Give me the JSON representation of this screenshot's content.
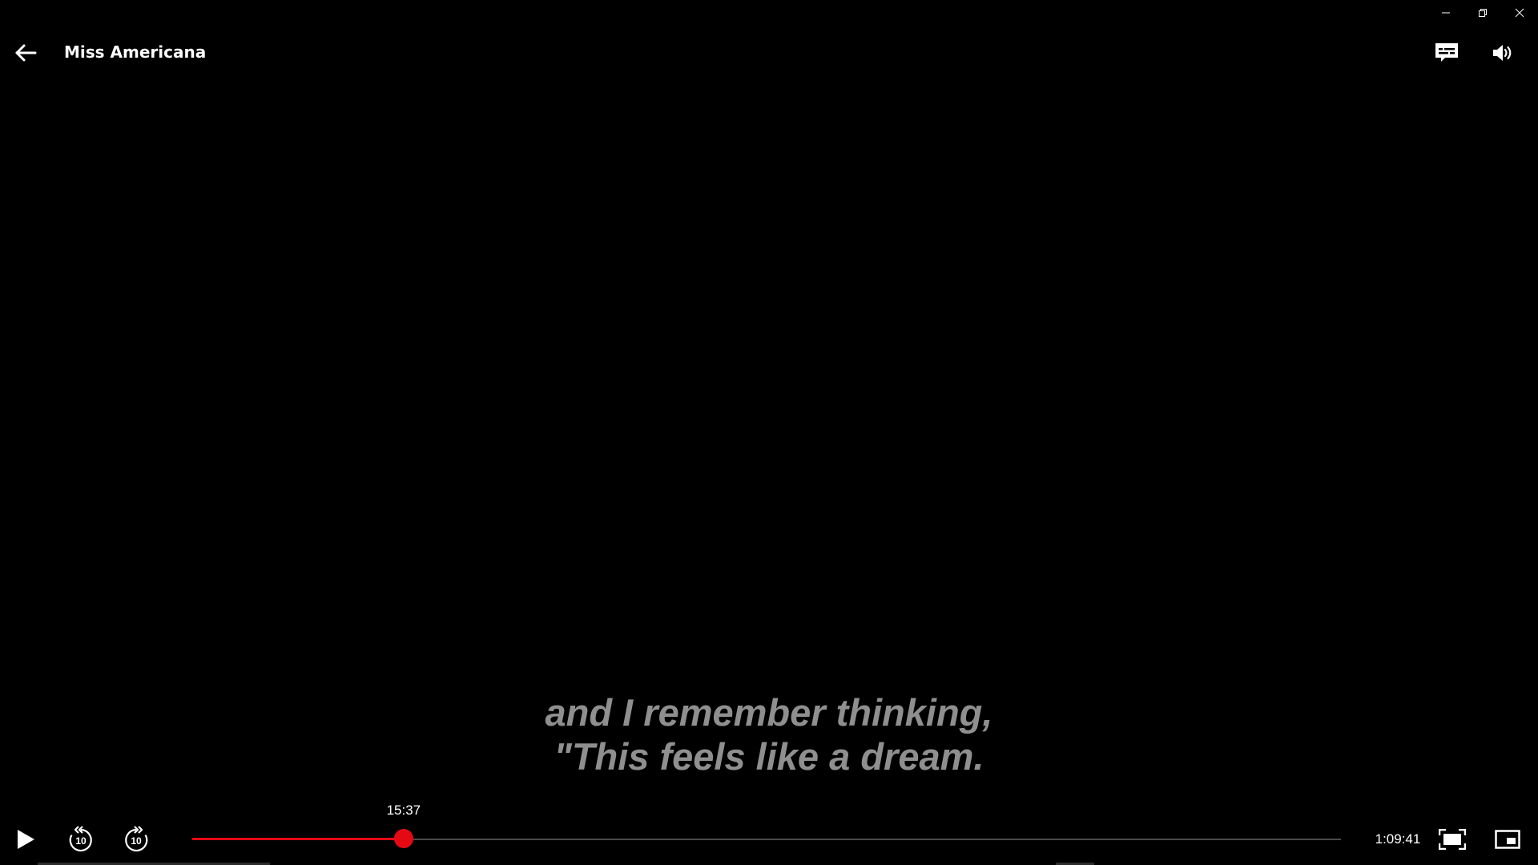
{
  "window": {
    "minimize_icon": "minimize-icon",
    "restore_icon": "restore-icon",
    "close_icon": "close-icon"
  },
  "header": {
    "back_icon": "back-arrow-icon",
    "title": "Miss Americana",
    "subtitles_icon": "subtitles-icon",
    "volume_icon": "volume-icon"
  },
  "subtitle": {
    "line1": "and I remember thinking,",
    "line2": "\"This feels like a dream."
  },
  "controls": {
    "play_icon": "play-icon",
    "rewind_icon": "rewind-10-icon",
    "rewind_label": "10",
    "forward_icon": "forward-10-icon",
    "forward_label": "10",
    "current_time": "15:37",
    "remaining_time": "1:09:41",
    "progress_fraction": 0.184,
    "fullscreen_icon": "fullscreen-icon",
    "pip_icon": "picture-in-picture-icon"
  },
  "colors": {
    "accent": "#e50914",
    "background": "#000000",
    "subtitle": "#8f8f8f",
    "track": "#4a4a4a"
  }
}
